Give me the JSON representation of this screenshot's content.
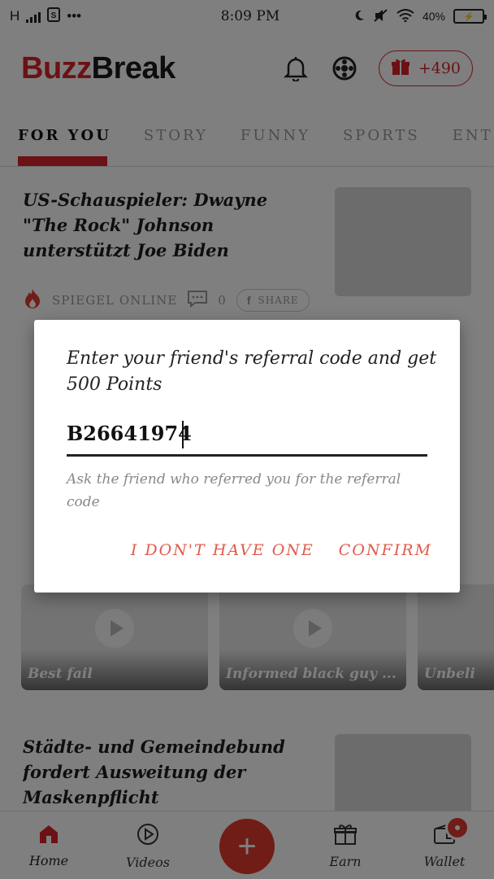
{
  "status_bar": {
    "network": "H",
    "time": "8:09 PM",
    "battery_percent": "40%"
  },
  "app": {
    "logo_part1": "Buzz",
    "logo_part2": "Break",
    "points": "+490",
    "accent_color": "#d8232a"
  },
  "tabs": [
    {
      "label": "FOR YOU",
      "active": true
    },
    {
      "label": "STORY",
      "active": false
    },
    {
      "label": "FUNNY",
      "active": false
    },
    {
      "label": "SPORTS",
      "active": false
    },
    {
      "label": "ENT",
      "active": false
    }
  ],
  "feed": {
    "article1": {
      "title": "US-Schauspieler: Dwayne \"The Rock\" Johnson unterstützt Joe Biden",
      "source": "SPIEGEL ONLINE",
      "comments": "0",
      "share": "SHARE"
    },
    "videos": [
      {
        "title": "Best fail"
      },
      {
        "title": "Informed black guy ..."
      },
      {
        "title": "Unbeli"
      }
    ],
    "article2": {
      "title": "Städte- und Gemeindebund fordert Ausweitung der Maskenpflicht"
    }
  },
  "bottom_nav": {
    "home": "Home",
    "videos": "Videos",
    "add": "+",
    "earn": "Earn",
    "wallet": "Wallet"
  },
  "dialog": {
    "title": "Enter your friend's referral code and get 500 Points",
    "input_value": "B26641974",
    "hint": "Ask the friend who referred you for the referral code",
    "btn_no_code": "I DON'T HAVE ONE",
    "btn_confirm": "CONFIRM"
  }
}
